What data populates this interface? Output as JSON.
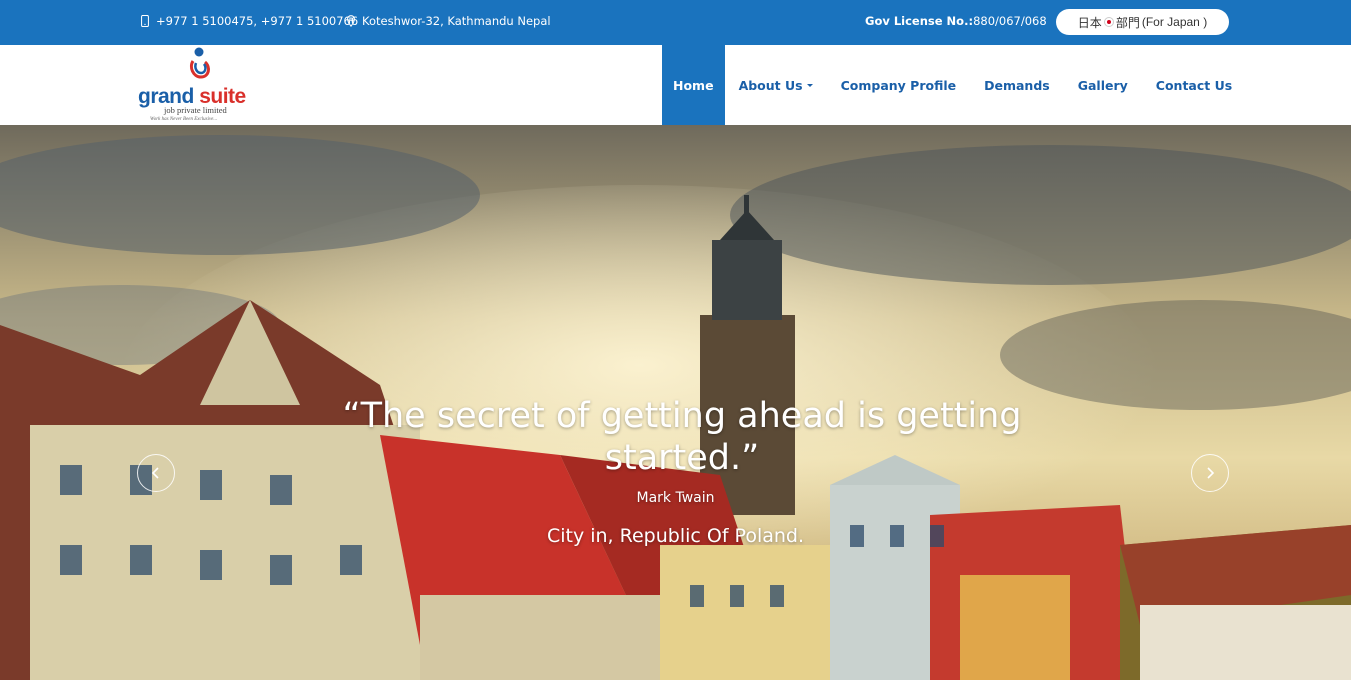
{
  "topbar": {
    "phone": "+977 1 5100475, +977 1 5100766",
    "address": "Koteshwor-32, Kathmandu Nepal",
    "license_label": "Gov License No.:",
    "license_number": "880/067/068",
    "japan_button": {
      "prefix": "日本",
      "suffix": "部門",
      "label": "(For Japan )"
    }
  },
  "logo": {
    "brand_first": "grand",
    "brand_second": "suite",
    "subtitle": "job private limited",
    "tagline": "Work has Never Been Exclusive..."
  },
  "nav": {
    "items": [
      {
        "label": "Home",
        "active": true
      },
      {
        "label": "About Us",
        "dropdown": true
      },
      {
        "label": "Company Profile"
      },
      {
        "label": "Demands"
      },
      {
        "label": "Gallery"
      },
      {
        "label": "Contact Us"
      }
    ]
  },
  "hero": {
    "quote": "“The secret of getting ahead is getting started.”",
    "author": "Mark Twain",
    "location": "City in, Republic Of Poland.",
    "prev_icon": "chevron-left-icon",
    "next_icon": "chevron-right-icon"
  },
  "colors": {
    "primary": "#1a73be",
    "nav_text": "#1a5fa8",
    "logo_red": "#d9302b"
  }
}
